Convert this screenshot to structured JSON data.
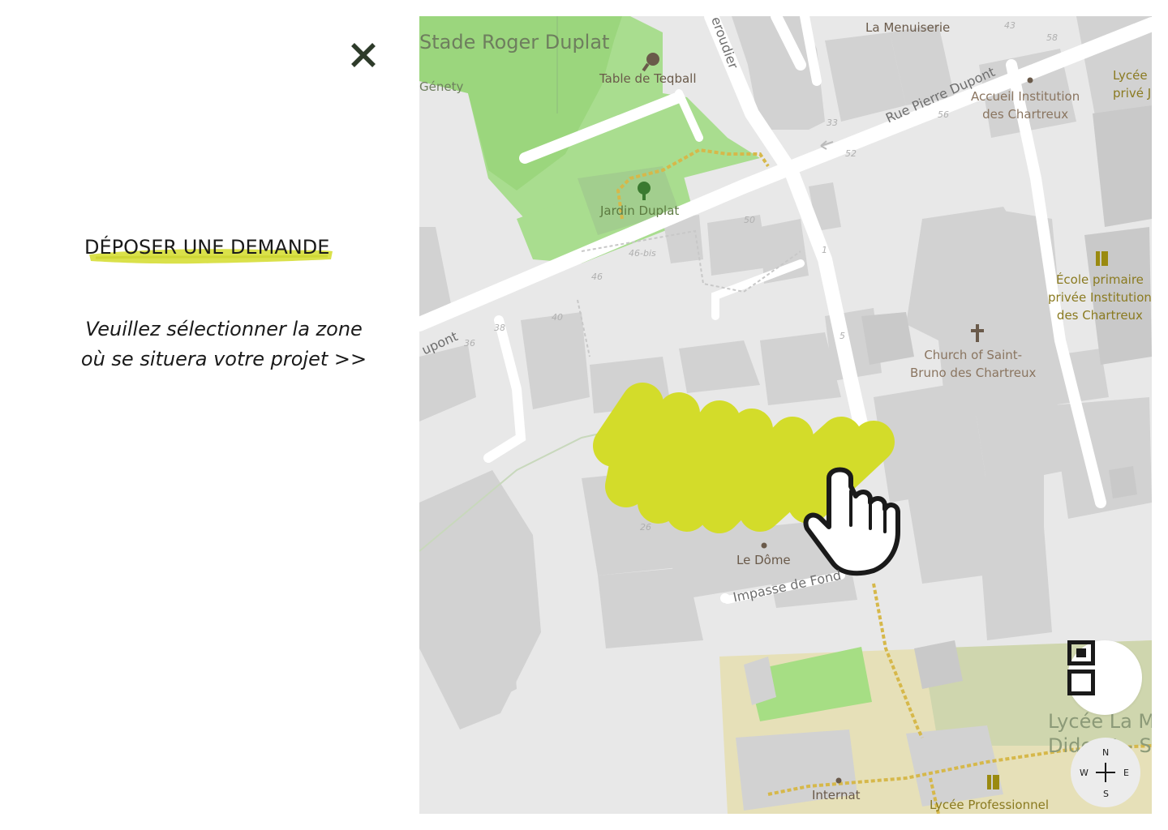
{
  "panel": {
    "title": "DÉPOSER UNE DEMANDE",
    "instruction_line1": "Veuillez sélectionner la zone",
    "instruction_line2": "où se situera votre projet >>"
  },
  "colors": {
    "accent": "#d3dc2a",
    "close_icon": "#2e3b2a",
    "text": "#1a1a1a"
  },
  "icons": {
    "close": "close-icon",
    "pointer": "pointing-hand-icon",
    "layers": "layers-icon",
    "compass": "compass-icon"
  },
  "map": {
    "places": {
      "stade": "Stade Roger Duplat",
      "genety": "Génety",
      "teqball": "Table de Teqball",
      "jardin": "Jardin Duplat",
      "menuiserie": "La Menuiserie",
      "accueil_1": "Accueil Institution",
      "accueil_2": "des Chartreux",
      "lycee_prive_1": "Lycée",
      "lycee_prive_2": "privé J",
      "ecole_1": "École primaire",
      "ecole_2": "privée Institution",
      "ecole_3": "des Chartreux",
      "church_1": "Church of Saint-",
      "church_2": "Bruno des Chartreux",
      "le_dome": "Le Dôme",
      "internat": "Internat",
      "lycee_pro": "Lycée Professionnel",
      "lycee_la_1": "Lycée La M",
      "lycee_la_2": "Diderot - Si"
    },
    "streets": {
      "pierre_dupont": "Rue Pierre Dupont",
      "dupont": "upont",
      "peroudier": "eroudier",
      "impasse": "Impasse de Fond"
    },
    "numbers": {
      "n43": "43",
      "n58": "58",
      "n56": "56",
      "n33": "33",
      "n52": "52",
      "n50": "50",
      "n46bis": "46-bis",
      "n46": "46",
      "n40": "40",
      "n38": "38",
      "n36": "36",
      "n1": "1",
      "n5": "5",
      "n26": "26"
    },
    "compass": {
      "n": "N",
      "s": "S",
      "e": "E",
      "w": "W"
    }
  }
}
